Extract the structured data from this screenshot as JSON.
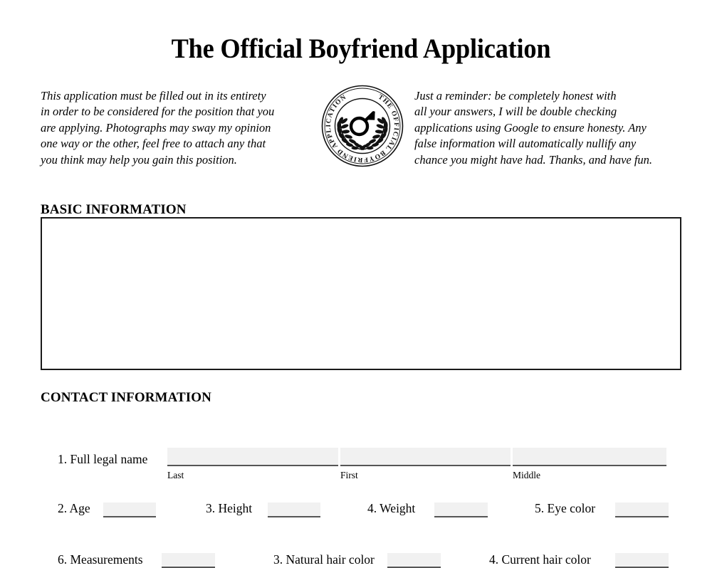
{
  "document": {
    "title": "The Official Boyfriend Application"
  },
  "intro": {
    "left_lines": [
      "This application must be filled out in its entirety",
      "in order to be considered for the position that you",
      "are applying. Photographs may sway my opinion",
      "one way or the other, feel free to attach any that",
      "you think may help you  gain this position."
    ],
    "right_lines": [
      "Just a reminder: be completely honest with",
      "all your answers, I will be double checking",
      "applications using Google to ensure honesty. Any",
      "false information will automatically nullify any",
      "chance you might have had. Thanks, and have fun."
    ]
  },
  "seal": {
    "text": "THE OFFICIAL BOYFRIEND APPLICATION",
    "emblem": "mars-symbol",
    "wreath": "laurel-wreath"
  },
  "sections": {
    "basic_information": "BASIC INFORMATION",
    "contact_information": "CONTACT INFORMATION"
  },
  "basic_information": {
    "row1": {
      "label": "1. Full legal name",
      "fields": [
        {
          "name": "last",
          "value": "",
          "sublabel": "Last"
        },
        {
          "name": "first",
          "value": "",
          "sublabel": "First"
        },
        {
          "name": "middle",
          "value": "",
          "sublabel": "Middle"
        }
      ]
    },
    "row2": [
      {
        "label": "2. Age",
        "value": ""
      },
      {
        "label": "3. Height",
        "value": ""
      },
      {
        "label": "4. Weight",
        "value": ""
      },
      {
        "label": "5. Eye color",
        "value": ""
      }
    ],
    "row3": [
      {
        "label": "6. Measurements",
        "value": ""
      },
      {
        "label": "3. Natural hair color",
        "value": ""
      },
      {
        "label": "4. Current hair color",
        "value": ""
      }
    ]
  },
  "colors": {
    "page_background": "#ffffff",
    "text": "#000000",
    "field_fill": "#f1f1f1",
    "field_underline": "#555555",
    "box_border": "#1a1a1a"
  }
}
